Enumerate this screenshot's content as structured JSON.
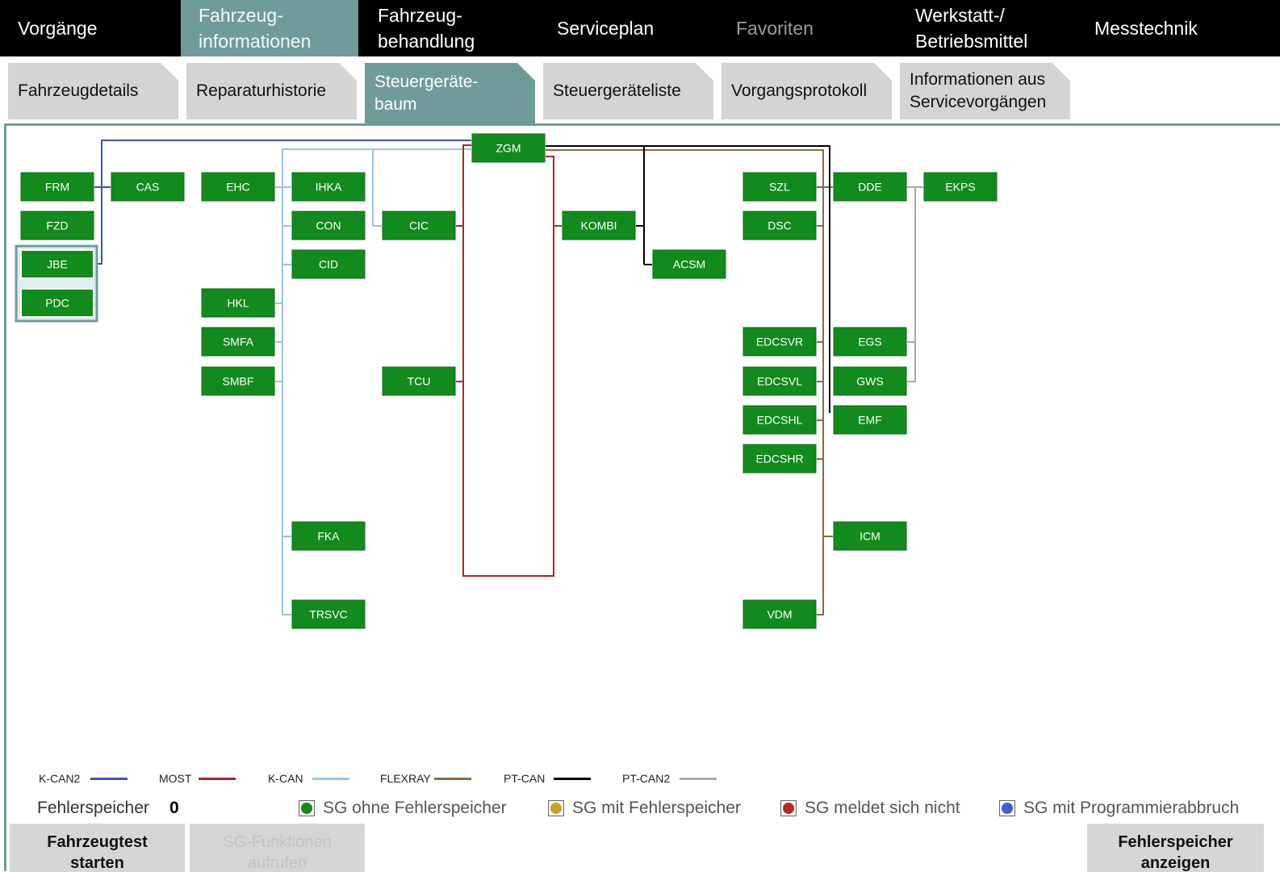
{
  "main_tabs": [
    {
      "label": "Vorgänge",
      "state": "normal"
    },
    {
      "label": "Fahrzeug-\ninformationen",
      "state": "active"
    },
    {
      "label": "Fahrzeug-\nbehandlung",
      "state": "normal"
    },
    {
      "label": "Serviceplan",
      "state": "normal"
    },
    {
      "label": "Favoriten",
      "state": "disabled"
    },
    {
      "label": "Werkstatt-/\nBetriebsmittel",
      "state": "normal"
    },
    {
      "label": "Messtechnik",
      "state": "normal"
    }
  ],
  "sub_tabs": [
    {
      "label": "Fahrzeugdetails"
    },
    {
      "label": "Reparaturhistorie"
    },
    {
      "label": "Steuergeräte-\nbaum",
      "active": true
    },
    {
      "label": "Steuergeräteliste"
    },
    {
      "label": "Vorgangsprotokoll"
    },
    {
      "label": "Informationen aus\nServicevorgängen"
    }
  ],
  "buses": {
    "kcan2": {
      "label": "K-CAN2",
      "color": "#3a55b0"
    },
    "most": {
      "label": "MOST",
      "color": "#a52a2a"
    },
    "kcan": {
      "label": "K-CAN",
      "color": "#9ec4e4"
    },
    "flexray": {
      "label": "FLEXRAY",
      "color": "#8b6b3d"
    },
    "ptcan": {
      "label": "PT-CAN",
      "color": "#000000"
    },
    "ptcan2": {
      "label": "PT-CAN2",
      "color": "#a9a9a9"
    }
  },
  "ecus": [
    "ZGM",
    "FRM",
    "FZD",
    "JBE",
    "PDC",
    "CAS",
    "EHC",
    "HKL",
    "SMFA",
    "SMBF",
    "IHKA",
    "CON",
    "CID",
    "FKA",
    "TRSVC",
    "CIC",
    "TCU",
    "KOMBI",
    "ACSM",
    "SZL",
    "DSC",
    "EDCSVR",
    "EDCSVL",
    "EDCSHL",
    "EDCSHR",
    "VDM",
    "DDE",
    "EGS",
    "GWS",
    "EMF",
    "ICM",
    "EKPS"
  ],
  "selected_ecus": [
    "JBE",
    "PDC"
  ],
  "ecu_color": "#138a1e",
  "fehlerspeicher": {
    "label": "Fehlerspeicher",
    "count": "0"
  },
  "status_keys": [
    {
      "label": "SG ohne Fehlerspeicher",
      "color": "#138a1e"
    },
    {
      "label": "SG mit Fehlerspeicher",
      "color": "#c9a227"
    },
    {
      "label": "SG meldet sich nicht",
      "color": "#b02a2a"
    },
    {
      "label": "SG mit Programmierabbruch",
      "color": "#3f5fcf"
    }
  ],
  "buttons": {
    "fahrzeugtest": "Fahrzeugtest\nstarten",
    "sg_funktionen": "SG-Funktionen\naufrufen",
    "fehlerspeicher_anzeigen": "Fehlerspeicher\nanzeigen"
  }
}
